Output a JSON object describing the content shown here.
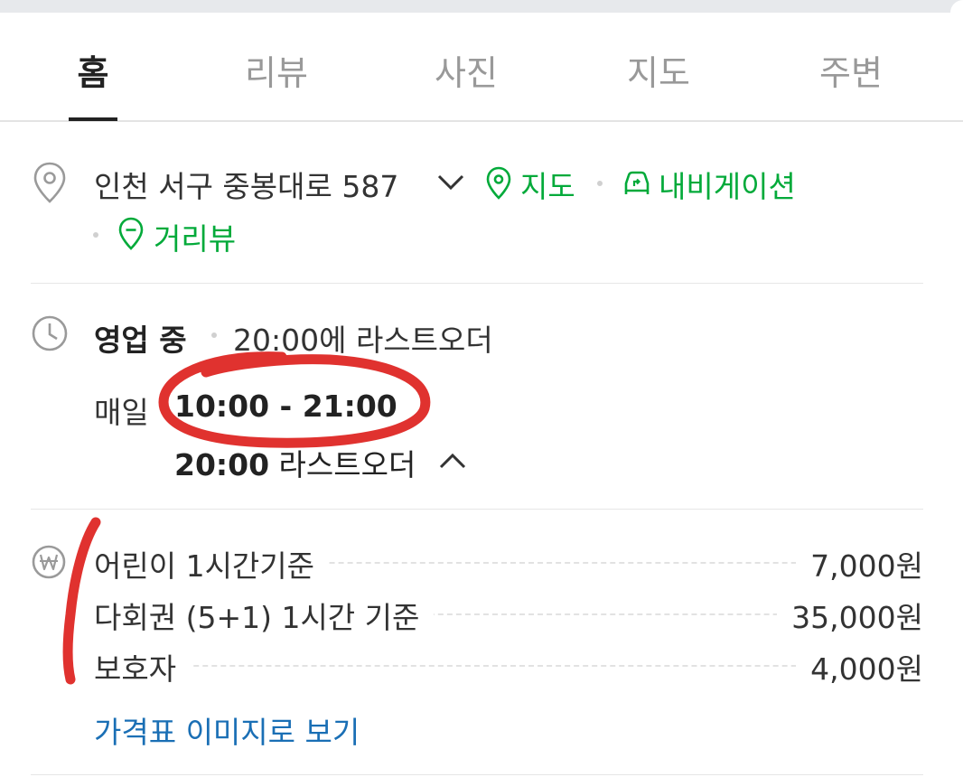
{
  "tabs": [
    {
      "label": "홈",
      "active": true
    },
    {
      "label": "리뷰",
      "active": false
    },
    {
      "label": "사진",
      "active": false
    },
    {
      "label": "지도",
      "active": false
    },
    {
      "label": "주변",
      "active": false
    }
  ],
  "address": {
    "text": "인천 서구 중봉대로 587",
    "links": {
      "map": "지도",
      "navigation": "내비게이션",
      "street_view": "거리뷰"
    }
  },
  "hours": {
    "status": "영업 중",
    "last_order_inline": "20:00에 라스트오더",
    "daily_label": "매일",
    "range": "10:00 - 21:00",
    "last_order_time": "20:00",
    "last_order_label": "라스트오더"
  },
  "prices": {
    "items": [
      {
        "name": "어린이 1시간기준",
        "price": "7,000원"
      },
      {
        "name": "다회권 (5+1) 1시간 기준",
        "price": "35,000원"
      },
      {
        "name": "보호자",
        "price": "4,000원"
      }
    ],
    "image_link": "가격표 이미지로 보기"
  },
  "colors": {
    "green_link": "#03aa3a",
    "blue_link": "#1a6fb5",
    "annotation_red": "#e0322f"
  }
}
